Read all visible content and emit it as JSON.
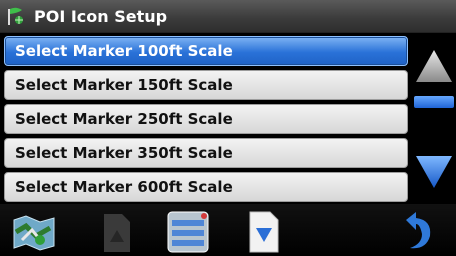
{
  "header": {
    "title": "POI Icon Setup",
    "icon": "poi-flag-icon"
  },
  "list": {
    "items": [
      {
        "label": "Select Marker 100ft Scale",
        "selected": true
      },
      {
        "label": "Select Marker 150ft Scale",
        "selected": false
      },
      {
        "label": "Select Marker 250ft Scale",
        "selected": false
      },
      {
        "label": "Select Marker 350ft Scale",
        "selected": false
      },
      {
        "label": "Select Marker 600ft Scale",
        "selected": false
      }
    ]
  },
  "scrollbar": {
    "up_icon": "up-arrow-icon",
    "down_icon": "down-arrow-icon"
  },
  "toolbar": {
    "buttons": [
      {
        "name": "map-button",
        "icon": "map-icon"
      },
      {
        "name": "page-up-button",
        "icon": "page-up-icon"
      },
      {
        "name": "list-menu-button",
        "icon": "list-menu-icon"
      },
      {
        "name": "page-down-button",
        "icon": "page-down-icon"
      },
      {
        "name": "back-button",
        "icon": "back-arrow-icon"
      }
    ]
  },
  "colors": {
    "selection": "#2a72d8",
    "accent": "#1f64d6",
    "title_bar": "#3a3a3a"
  }
}
